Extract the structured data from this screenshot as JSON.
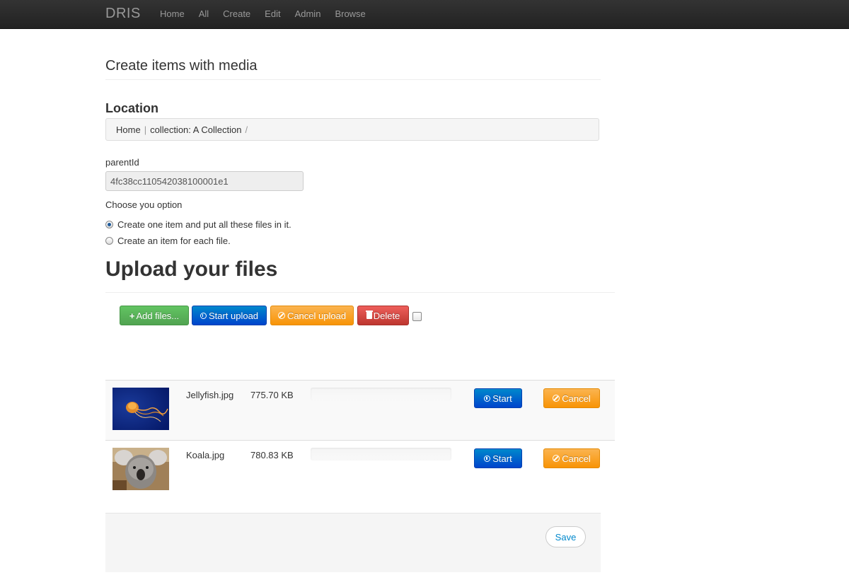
{
  "navbar": {
    "brand": "DRIS",
    "links": [
      "Home",
      "All",
      "Create",
      "Edit",
      "Admin",
      "Browse"
    ]
  },
  "page": {
    "title": "Create items with media"
  },
  "location": {
    "title": "Location",
    "breadcrumb": [
      {
        "label": "Home",
        "separator": "|"
      },
      {
        "label": "collection: A Collection",
        "separator": "/"
      }
    ]
  },
  "form": {
    "parent_label": "parentId",
    "parent_value": "4fc38cc110542038100001e1",
    "choose_label": "Choose you option",
    "options": [
      {
        "label": "Create one item and put all these files in it.",
        "checked": true
      },
      {
        "label": "Create an item for each file.",
        "checked": false
      }
    ]
  },
  "upload": {
    "title": "Upload your files",
    "toolbar": {
      "add_label": "Add files...",
      "start_label": "Start upload",
      "cancel_label": "Cancel upload",
      "delete_label": "Delete",
      "select_all_checked": false
    },
    "files": [
      {
        "name": "Jellyfish.jpg",
        "size": "775.70 KB",
        "progress": 0,
        "thumbnail": "jellyfish-image",
        "start_label": "Start",
        "cancel_label": "Cancel"
      },
      {
        "name": "Koala.jpg",
        "size": "780.83 KB",
        "progress": 0,
        "thumbnail": "koala-image",
        "start_label": "Start",
        "cancel_label": "Cancel"
      }
    ]
  },
  "actions": {
    "save_label": "Save"
  },
  "colors": {
    "navbar": "#222222",
    "green": "#51a351",
    "blue": "#0044cc",
    "orange": "#f89406",
    "red": "#bd362f",
    "link": "#0088cc"
  }
}
